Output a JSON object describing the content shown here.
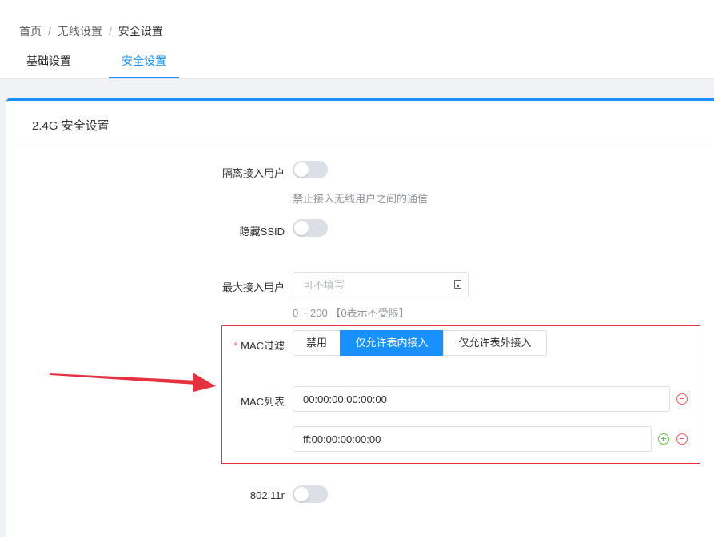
{
  "breadcrumb": {
    "home": "首页",
    "wireless": "无线设置",
    "current": "安全设置",
    "separator": "/"
  },
  "tabs": {
    "basic": "基础设置",
    "security": "安全设置"
  },
  "card": {
    "title": "2.4G 安全设置"
  },
  "form": {
    "isolate_label": "隔离接入用户",
    "isolate_enabled": false,
    "isolate_hint": "禁止接入无线用户之间的通信",
    "hide_ssid_label": "隐藏SSID",
    "hide_ssid_enabled": false,
    "max_users_label": "最大接入用户",
    "max_users_placeholder": "可不填写",
    "max_users_value": "",
    "max_users_hint": "0 ~ 200 【0表示不受限】",
    "mac_filter_required": "*",
    "mac_filter_label": "MAC过滤",
    "mac_filter_options": [
      "禁用",
      "仅允许表内接入",
      "仅允许表外接入"
    ],
    "mac_filter_selected": "仅允许表内接入",
    "mac_list_label": "MAC列表",
    "mac_list": [
      "00:00:00:00:00:00",
      "ff:00:00:00:00:00"
    ],
    "ieee80211r_label": "802.11r",
    "ieee80211r_enabled": false
  },
  "colors": {
    "accent": "#1890ff",
    "annotation_red": "#e5323e",
    "add_green": "#5fbf3a",
    "remove_red": "#f05a5a"
  }
}
